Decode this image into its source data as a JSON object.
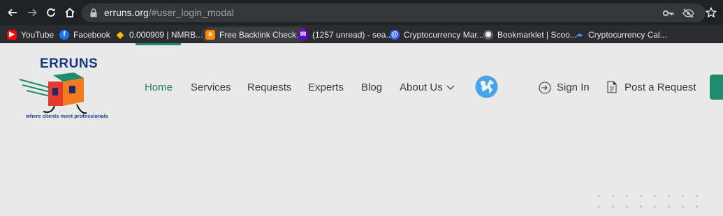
{
  "browser": {
    "url_host": "erruns.org",
    "url_path": "/#user_login_modal",
    "bookmarks": [
      {
        "label": "YouTube",
        "icon": "youtube-icon"
      },
      {
        "label": "Facebook",
        "icon": "facebook-icon"
      },
      {
        "label": "0.000909 | NMRB...",
        "icon": "binance-icon"
      },
      {
        "label": "Free Backlink Check...",
        "icon": "ahrefs-icon"
      },
      {
        "label": "(1257 unread) - sea...",
        "icon": "yahoo-mail-icon"
      },
      {
        "label": "Cryptocurrency Mar...",
        "icon": "coinmarketcap-icon"
      },
      {
        "label": "Bookmarklet | Scoo...",
        "icon": "scoopit-icon"
      },
      {
        "label": "Cryptocurrency Cal...",
        "icon": "coinmarketcal-icon"
      }
    ]
  },
  "site": {
    "logo_title": "ERRUNS",
    "logo_tagline": "where clients meet professionals",
    "nav": {
      "home": "Home",
      "services": "Services",
      "requests": "Requests",
      "experts": "Experts",
      "blog": "Blog",
      "about": "About Us"
    },
    "sign_in": "Sign In",
    "post_request": "Post a Request"
  },
  "colors": {
    "accent": "#1f8a6c",
    "chrome_bg": "#202124",
    "page_bg": "#e9e9e9"
  }
}
